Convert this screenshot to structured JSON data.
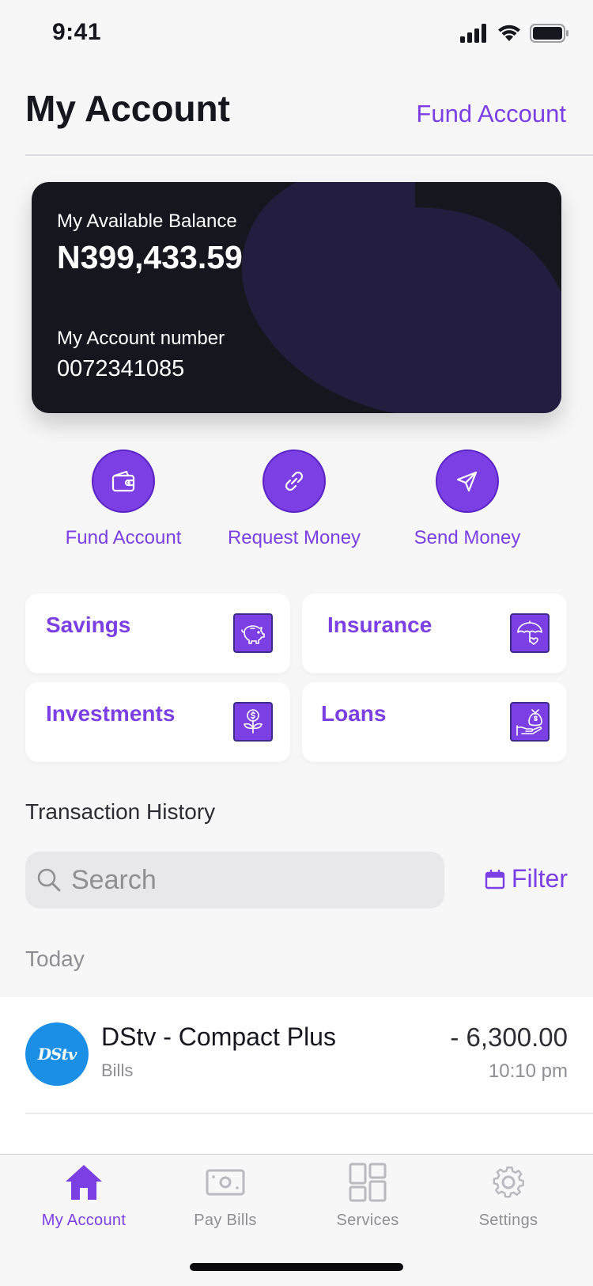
{
  "status_bar": {
    "time": "9:41"
  },
  "header": {
    "title": "My Account",
    "fund_link": "Fund Account"
  },
  "balance_card": {
    "balance_label": "My Available Balance",
    "balance_value": "N399,433.59",
    "account_label": "My Account number",
    "account_number": "0072341085"
  },
  "actions": [
    {
      "label": "Fund Account",
      "icon": "wallet-icon"
    },
    {
      "label": "Request Money",
      "icon": "link-icon"
    },
    {
      "label": "Send Money",
      "icon": "send-icon"
    }
  ],
  "products": [
    {
      "label": "Savings",
      "icon": "piggy-bank-icon"
    },
    {
      "label": "Insurance",
      "icon": "umbrella-heart-icon"
    },
    {
      "label": "Investments",
      "icon": "plant-money-icon"
    },
    {
      "label": "Loans",
      "icon": "money-bag-hand-icon"
    }
  ],
  "transactions": {
    "title": "Transaction History",
    "search_placeholder": "Search",
    "filter_label": "Filter",
    "groups": [
      {
        "date": "Today",
        "items": [
          {
            "logo_text": "DStv",
            "title": "DStv - Compact Plus",
            "category": "Bills",
            "amount": "- 6,300.00",
            "time": "10:10 pm"
          }
        ]
      }
    ]
  },
  "tab_bar": [
    {
      "label": "My Account",
      "icon": "home-icon",
      "active": true
    },
    {
      "label": "Pay Bills",
      "icon": "cash-icon",
      "active": false
    },
    {
      "label": "Services",
      "icon": "grid-icon",
      "active": false
    },
    {
      "label": "Settings",
      "icon": "gear-icon",
      "active": false
    }
  ],
  "colors": {
    "accent": "#7b3fe4",
    "card_background": "#16161f",
    "card_decoration": "#231d3f",
    "dstv_blue": "#1b8fe6"
  }
}
